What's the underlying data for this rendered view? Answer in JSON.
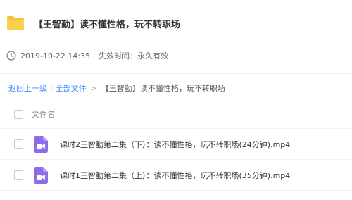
{
  "share": {
    "title": "【王智勤】读不懂性格，玩不转职场",
    "date": "2019-10-22 14:35",
    "expire": "失效时间：永久有效",
    "folder_icon": "folder-icon",
    "clock_icon": "clock-icon"
  },
  "breadcrumb": {
    "back_label": "返回上一级",
    "separator": "|",
    "all_files_label": "全部文件",
    "arrow": ">",
    "current": "【王智勤】读不懂性格，玩不转职场"
  },
  "list": {
    "column_header": "文件名",
    "files": [
      {
        "name": "课时2王智勤第二集（下）：读不懂性格，玩不转职场(24分钟).mp4",
        "icon": "video-file-icon"
      },
      {
        "name": "课时1王智勤第二集（上）：读不懂性格，玩不转职场(35分钟).mp4",
        "icon": "video-file-icon"
      }
    ]
  },
  "colors": {
    "folder": "#f9c43a",
    "link": "#3b8cff",
    "video_icon": "#8a6de9"
  }
}
